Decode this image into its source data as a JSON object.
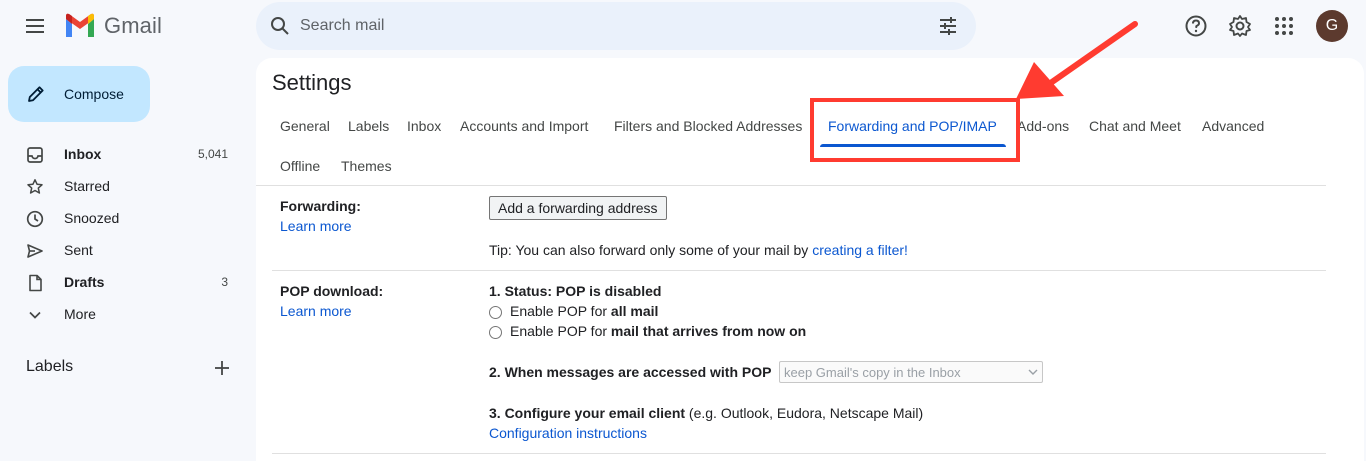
{
  "header": {
    "app_name": "Gmail",
    "search_placeholder": "Search mail",
    "avatar_letter": "G"
  },
  "sidebar": {
    "compose_label": "Compose",
    "items": [
      {
        "label": "Inbox",
        "count": "5,041",
        "icon": "inbox-icon",
        "bold": true
      },
      {
        "label": "Starred",
        "count": "",
        "icon": "star-icon",
        "bold": false
      },
      {
        "label": "Snoozed",
        "count": "",
        "icon": "clock-icon",
        "bold": false
      },
      {
        "label": "Sent",
        "count": "",
        "icon": "send-icon",
        "bold": false
      },
      {
        "label": "Drafts",
        "count": "3",
        "icon": "draft-icon",
        "bold": true
      },
      {
        "label": "More",
        "count": "",
        "icon": "chevron-down-icon",
        "bold": false
      }
    ],
    "labels_heading": "Labels"
  },
  "settings": {
    "title": "Settings",
    "tabs": [
      "General",
      "Labels",
      "Inbox",
      "Accounts and Import",
      "Filters and Blocked Addresses",
      "Forwarding and POP/IMAP",
      "Add-ons",
      "Chat and Meet",
      "Advanced",
      "Offline",
      "Themes"
    ],
    "active_tab": "Forwarding and POP/IMAP",
    "forwarding": {
      "label": "Forwarding:",
      "learn_more": "Learn more",
      "button": "Add a forwarding address",
      "tip_prefix": "Tip: You can also forward only some of your mail by ",
      "tip_link": "creating a filter!"
    },
    "pop": {
      "label": "POP download:",
      "learn_more": "Learn more",
      "status": "1. Status: POP is disabled",
      "option1_prefix": "Enable POP for ",
      "option1_bold": "all mail",
      "option2_prefix": "Enable POP for ",
      "option2_bold": "mail that arrives from now on",
      "when_accessed": "2. When messages are accessed with POP",
      "select_value": "keep Gmail's copy in the Inbox",
      "configure_bold": "3. Configure your email client",
      "configure_rest": " (e.g. Outlook, Eudora, Netscape Mail)",
      "config_link": "Configuration instructions"
    }
  },
  "colors": {
    "accent": "#0b57d0",
    "highlight": "#ff3b30",
    "compose_bg": "#c2e7ff"
  }
}
